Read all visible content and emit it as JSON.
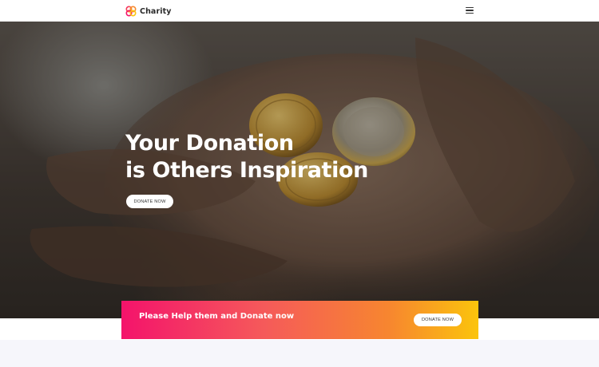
{
  "brand": {
    "name": "Charity",
    "logo_icon": "charity-logo-icon"
  },
  "nav": {
    "menu_icon": "hamburger-menu-icon"
  },
  "hero": {
    "title_line1": "Your Donation",
    "title_line2": "is Others Inspiration",
    "button_label": "DONATE NOW"
  },
  "cta": {
    "text": "Please Help them and Donate now",
    "button_label": "DONATE NOW"
  },
  "colors": {
    "gradient_start": "#f4136b",
    "gradient_end": "#fbc40c",
    "section_bg": "#f6f6fb"
  }
}
